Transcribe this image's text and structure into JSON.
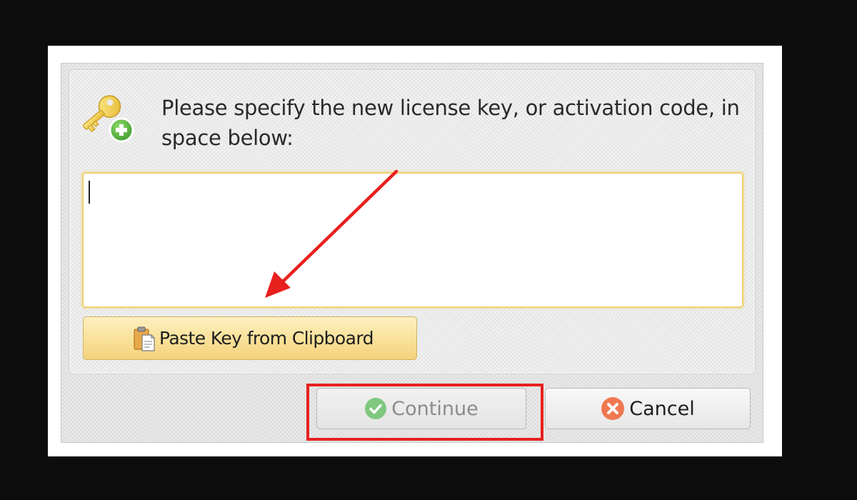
{
  "dialog": {
    "prompt": "Please specify the new license key, or activation code, in space below:",
    "key_input": {
      "value": "",
      "placeholder": ""
    },
    "paste_button": {
      "label": "Paste Key from Clipboard",
      "icon": "clipboard-paste-icon"
    },
    "header_icon": "key-add-icon",
    "continue_button": {
      "label": "Continue",
      "icon": "check-circle-icon",
      "enabled": false
    },
    "cancel_button": {
      "label": "Cancel",
      "icon": "x-circle-icon"
    }
  },
  "annotations": {
    "highlight_color": "#e8201e",
    "arrow_color": "#e8201e"
  },
  "colors": {
    "background": "#0c0c0c",
    "input_focus_border": "#f0d272",
    "paste_button_fill": "#f9e29b",
    "continue_icon": "#7fc87f",
    "cancel_icon": "#f07850"
  }
}
